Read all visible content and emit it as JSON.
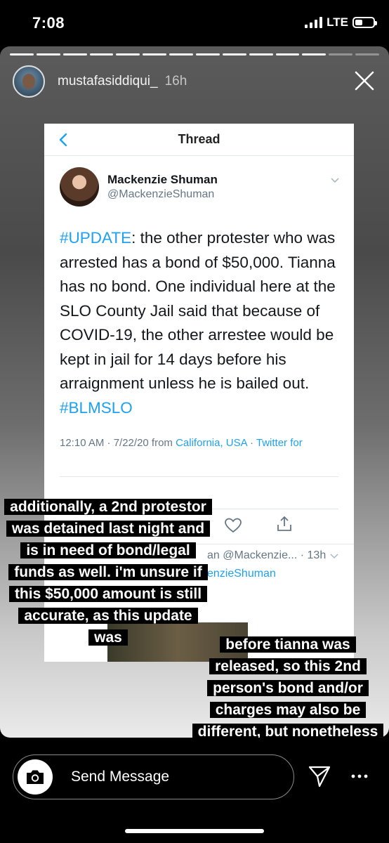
{
  "status_bar": {
    "time": "7:08",
    "network": "LTE",
    "signal_bars": 4,
    "battery_level": 0.4
  },
  "story": {
    "progress_segments": 14,
    "progress_done": 12,
    "username": "mustafasiddiqui_",
    "time_ago": "16h",
    "close_icon": "close-icon"
  },
  "tweet": {
    "nav_title": "Thread",
    "author_name": "Mackenzie Shuman",
    "author_handle": "@MackenzieShuman",
    "text_hashtag_start": "#UPDATE",
    "text_body": ": the other protester who was arrested has a bond of $50,000. Tianna has no bond. One individual here at the SLO County Jail said that because of COVID-19, the other arrestee would be kept in jail for 14 days before his arraignment unless he is bailed out. ",
    "text_hashtag_end": "#BLMSLO",
    "meta_time": "12:10 AM · 7/22/20 from ",
    "meta_location": "California, USA",
    "meta_separator": " · ",
    "meta_source": "Twitter for",
    "reply_handle": "an @Mackenzie... · 13h",
    "reply_handle2": "enzieShuman"
  },
  "captions": {
    "caption_1": "additionally, a 2nd protestor was detained last night and is in need of bond/legal funds as well. i'm unsure if this $50,000 amount is still accurate, as this update was",
    "caption_2": "before tianna was released, so this 2nd person's bond and/or charges may also be different, but nonetheless they need our help"
  },
  "bottom_bar": {
    "message_placeholder": "Send Message",
    "camera_icon": "camera-icon",
    "send_icon": "paper-plane-icon",
    "more_icon": "more-dots-icon"
  }
}
